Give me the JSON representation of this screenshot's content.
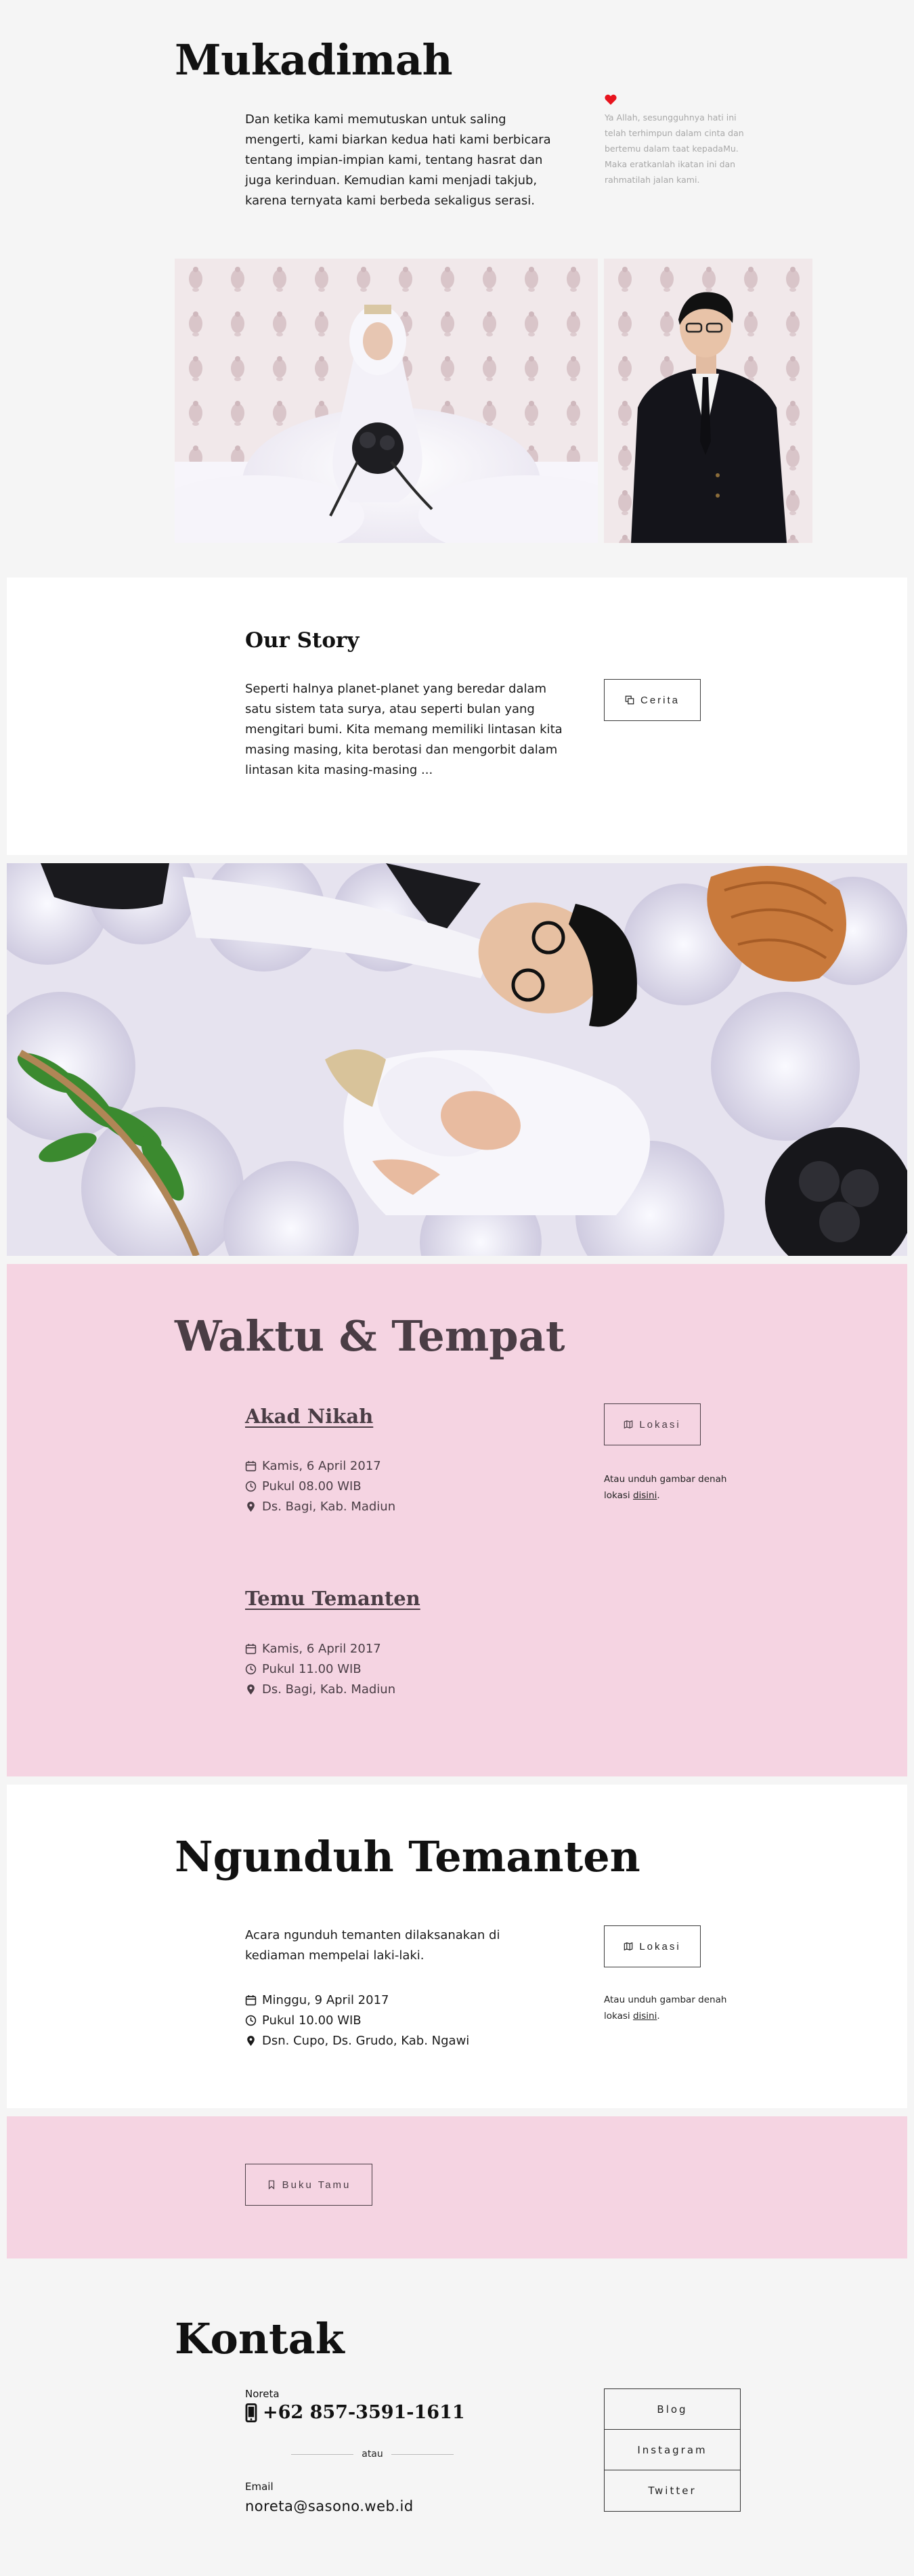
{
  "mukadimah": {
    "title": "Mukadimah",
    "intro": "Dan ketika kami memutuskan untuk saling mengerti, kami biarkan kedua hati kami berbicara tentang impian-impian kami, tentang hasrat dan juga kerinduan. Kemudian kami menjadi takjub, karena ternyata kami berbeda sekaligus serasi.",
    "prayer": "Ya Allah, sesungguhnya hati ini telah terhimpun dalam cinta dan bertemu dalam taat kepadaMu. Maka eratkanlah ikatan ini dan rahmatilah jalan kami.",
    "heart_icon": "heart-icon",
    "heart_color": "#e8141e"
  },
  "story": {
    "title": "Our Story",
    "text": "Seperti halnya planet-planet yang beredar dalam satu sistem tata surya, atau seperti bulan yang mengitari bumi. Kita memang memiliki lintasan kita masing masing, kita berotasi dan mengorbit dalam lintasan kita masing-masing ...",
    "button_label": "Cerita"
  },
  "waktu": {
    "title": "Waktu & Tempat",
    "events": [
      {
        "name": "Akad Nikah",
        "date": "Kamis, 6 April 2017",
        "time": "Pukul 08.00 WIB",
        "place": "Ds. Bagi, Kab. Madiun"
      },
      {
        "name": "Temu Temanten",
        "date": "Kamis, 6 April 2017",
        "time": "Pukul 11.00 WIB",
        "place": "Ds. Bagi, Kab. Madiun"
      }
    ],
    "button_label": "Lokasi",
    "note_text": "Atau unduh gambar denah lokasi",
    "note_link": "disini",
    "note_end": "."
  },
  "ngunduh": {
    "title": "Ngunduh Temanten",
    "text": "Acara ngunduh temanten dilaksanakan di kediaman mempelai laki-laki.",
    "date": "Minggu, 9 April 2017",
    "time": "Pukul 10.00 WIB",
    "place": "Dsn. Cupo, Ds. Grudo, Kab. Ngawi",
    "button_label": "Lokasi",
    "note_text": "Atau unduh gambar denah lokasi",
    "note_link": "disini",
    "note_end": "."
  },
  "tamu": {
    "button_label": "Buku Tamu"
  },
  "kontak": {
    "title": "Kontak",
    "name": "Noreta",
    "phone": "+62 857-3591-1611",
    "separator": "atau",
    "email_label": "Email",
    "email": "noreta@sasono.web.id",
    "social": [
      "Blog",
      "Instagram",
      "Twitter"
    ]
  },
  "colors": {
    "pink_bg": "#f5d4e2",
    "muted_text": "#4a3d45",
    "page_bg": "#f5f5f5"
  }
}
